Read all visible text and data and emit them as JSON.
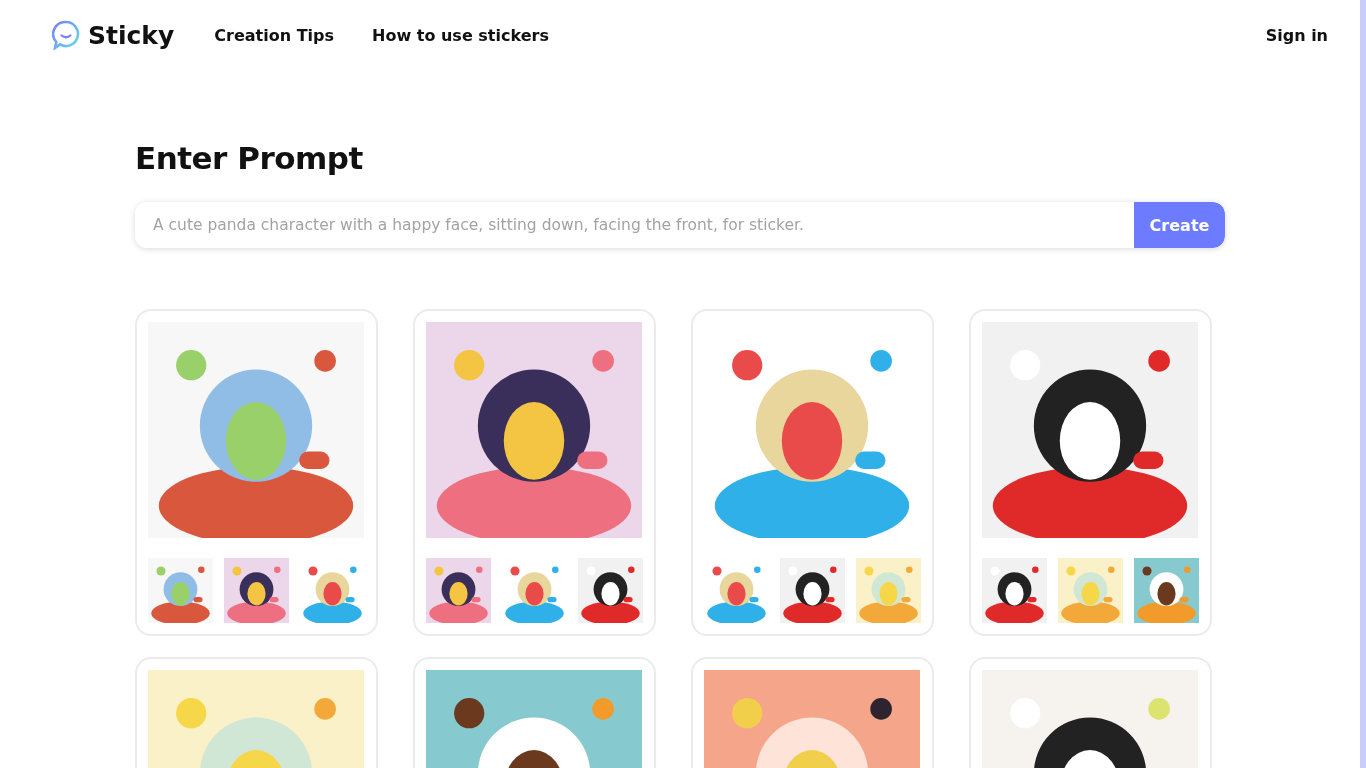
{
  "header": {
    "brand": "Sticky",
    "nav": [
      {
        "label": "Creation Tips"
      },
      {
        "label": "How to use stickers"
      }
    ],
    "sign_in": "Sign in"
  },
  "prompt": {
    "heading": "Enter Prompt",
    "placeholder": "A cute panda character with a happy face, sitting down, facing the front, for sticker.",
    "button": "Create"
  },
  "cards": [
    {
      "kind": "picture",
      "thumbnails": [
        {
          "kind": "picture"
        },
        {
          "kind": "picture"
        },
        {
          "kind": "picture"
        }
      ]
    },
    {
      "kind": "picture",
      "thumbnails": [
        {
          "kind": "picture"
        },
        {
          "kind": "picture"
        },
        {
          "kind": "picture"
        }
      ]
    },
    {
      "kind": "picture",
      "thumbnails": [
        {
          "kind": "picture"
        },
        {
          "kind": "picture"
        },
        {
          "kind": "picture"
        }
      ]
    },
    {
      "kind": "picture",
      "thumbnails": [
        {
          "kind": "picture"
        },
        {
          "kind": "picture"
        },
        {
          "kind": "picture"
        }
      ]
    },
    {
      "kind": "picture"
    },
    {
      "kind": "picture"
    },
    {
      "kind": "picture"
    },
    {
      "kind": "picture"
    }
  ]
}
